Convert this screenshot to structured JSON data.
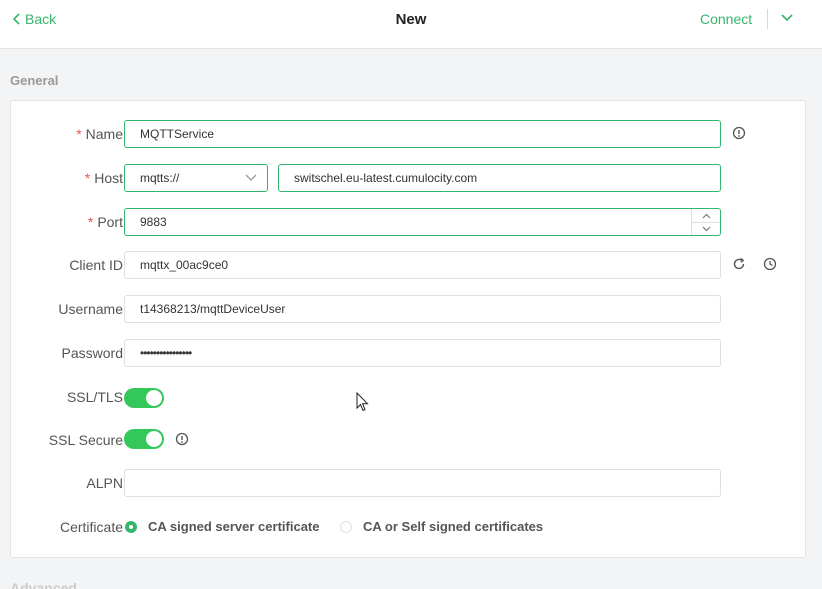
{
  "header": {
    "back_label": "Back",
    "title": "New",
    "connect_label": "Connect"
  },
  "general": {
    "section_title": "General",
    "required_mark": "*",
    "fields": {
      "name": {
        "label": "Name",
        "value": "MQTTService"
      },
      "host": {
        "label": "Host",
        "protocol": "mqtts://",
        "value": "switschel.eu-latest.cumulocity.com"
      },
      "port": {
        "label": "Port",
        "value": "9883"
      },
      "client_id": {
        "label": "Client ID",
        "value": "mqttx_00ac9ce0"
      },
      "username": {
        "label": "Username",
        "value": "t14368213/mqttDeviceUser"
      },
      "password": {
        "label": "Password",
        "value": "••••••••••••••••"
      },
      "ssl_tls": {
        "label": "SSL/TLS",
        "enabled": true
      },
      "ssl_secure": {
        "label": "SSL Secure",
        "enabled": true
      },
      "alpn": {
        "label": "ALPN",
        "value": ""
      },
      "certificate": {
        "label": "Certificate",
        "options": [
          "CA signed server certificate",
          "CA or Self signed certificates"
        ],
        "selected": "CA signed server certificate"
      }
    }
  },
  "next_section_title": "Advanced",
  "colors": {
    "accent": "#35b56b",
    "toggle_on": "#34c75a",
    "required": "#e15656"
  },
  "icons": [
    "chevron-left-icon",
    "chevron-down-icon",
    "info-icon",
    "refresh-icon",
    "clock-icon",
    "mouse-cursor-icon"
  ]
}
